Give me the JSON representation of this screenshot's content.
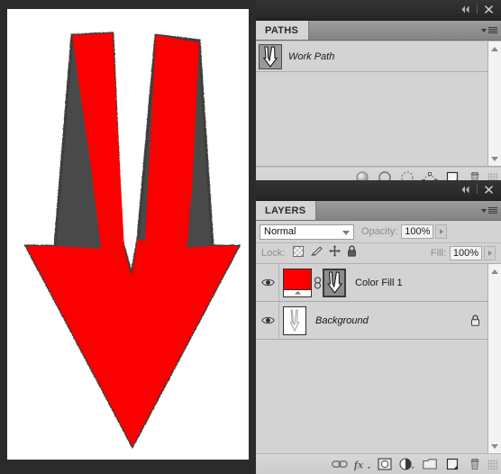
{
  "app": {
    "accent_red": "#FA0000",
    "panel_bg": "#D3D3D3",
    "chrome_dark": "#2D2D2D"
  },
  "canvas": {
    "name": "document-canvas",
    "background": "#FFFFFF",
    "artwork": "red-down-arrow"
  },
  "dock": {
    "titlebar": {
      "collapse_icon": "collapse-to-icons-icon",
      "close_icon": "close-icon"
    }
  },
  "paths_panel": {
    "tab_label": "PATHS",
    "menu_icon": "panel-menu-icon",
    "collapse_icon": "collapse-to-icons-icon",
    "close_icon": "close-icon",
    "rows": [
      {
        "name": "Work Path",
        "thumbnail": "path-thumbnail-arrow",
        "selected": false
      }
    ],
    "scrollbar": {
      "up_icon": "scroll-up-arrow-icon",
      "down_icon": "scroll-down-arrow-icon"
    },
    "footer_icons": [
      "fill-path-with-foreground-color-icon",
      "stroke-path-with-brush-icon",
      "load-path-as-selection-icon",
      "make-work-path-from-selection-icon",
      "create-new-path-icon",
      "delete-current-path-icon",
      "resize-grip-icon"
    ]
  },
  "layers_panel": {
    "tab_label": "LAYERS",
    "menu_icon": "panel-menu-icon",
    "collapse_icon": "collapse-to-icons-icon",
    "close_icon": "close-icon",
    "blend_mode": "Normal",
    "blend_mode_options": [
      "Normal"
    ],
    "opacity_label": "Opacity:",
    "opacity_value": "100%",
    "lock_label": "Lock:",
    "lock_icons": [
      "lock-transparent-pixels-icon",
      "lock-image-pixels-icon",
      "lock-position-icon",
      "lock-all-icon"
    ],
    "fill_label": "Fill:",
    "fill_value": "100%",
    "rows": [
      {
        "name": "Color Fill 1",
        "visible": true,
        "eye_icon": "layer-visibility-eye-icon",
        "thumbnail": "solid-color-fill-thumbnail",
        "thumbnail_color": "#FA0000",
        "link_icon": "layer-mask-link-icon",
        "mask_thumbnail": "vector-mask-thumbnail-arrow",
        "locked": false,
        "italic": false,
        "selected": false
      },
      {
        "name": "Background",
        "visible": true,
        "eye_icon": "layer-visibility-eye-icon",
        "thumbnail": "background-layer-thumbnail-arrow",
        "locked": true,
        "lock_icon": "locked-layer-padlock-icon",
        "italic": true,
        "selected": false
      }
    ],
    "scrollbar": {
      "up_icon": "scroll-up-arrow-icon",
      "down_icon": "scroll-down-arrow-icon"
    },
    "footer_icons": [
      "link-layers-icon",
      "add-layer-style-fx-icon",
      "add-layer-mask-icon",
      "create-new-fill-or-adjustment-layer-icon",
      "create-new-group-icon",
      "create-new-layer-icon",
      "delete-layer-icon",
      "resize-grip-icon"
    ]
  }
}
